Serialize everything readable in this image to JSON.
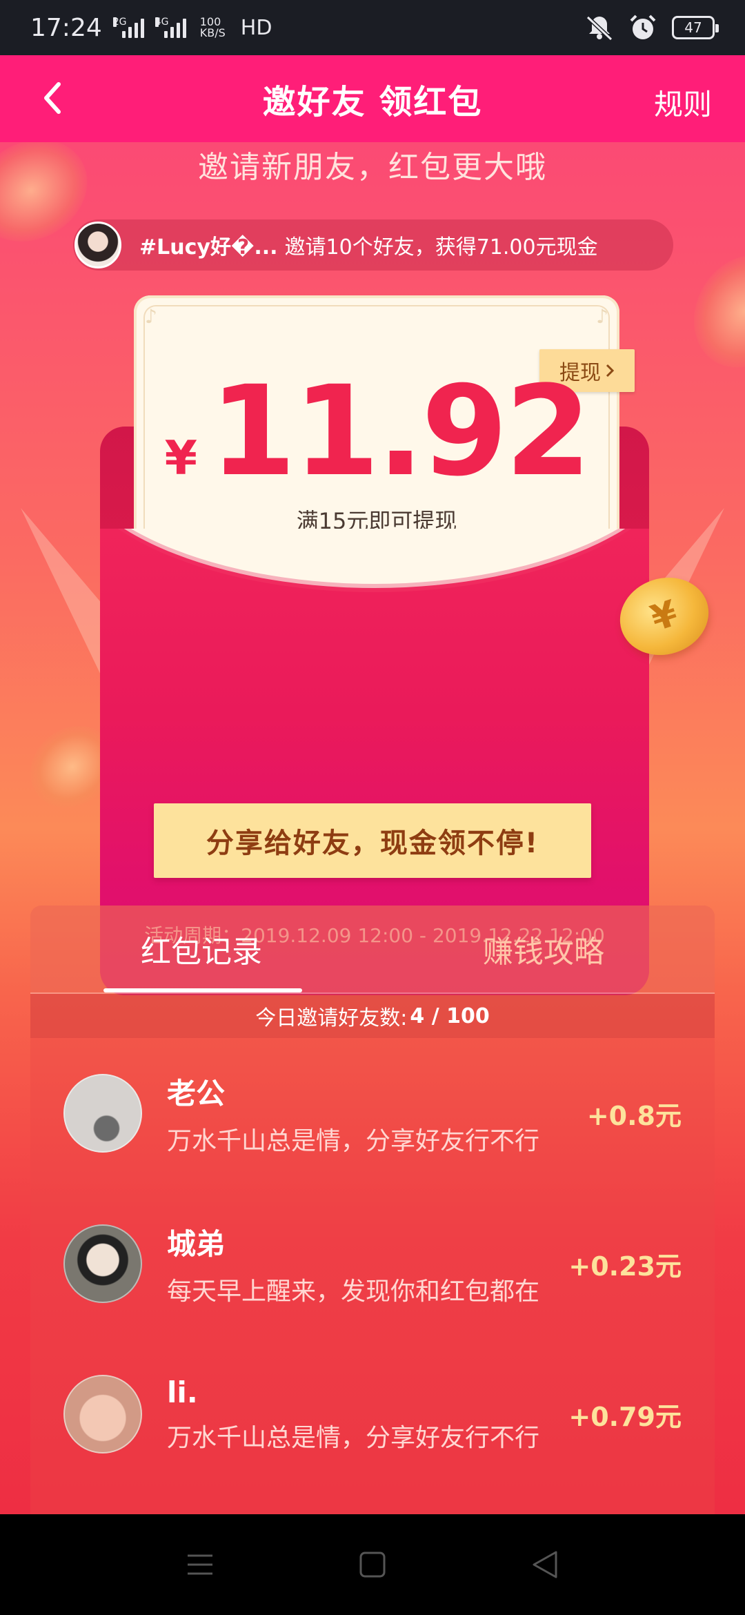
{
  "status_bar": {
    "time": "17:24",
    "sim1_label": "2G",
    "sim2_label": "4G",
    "net_speed_value": "100",
    "net_speed_unit": "KB/S",
    "hd_label": "HD",
    "battery": "47"
  },
  "header": {
    "title": "邀好友 领红包",
    "rules_label": "规则"
  },
  "subtitle": "邀请新朋友，红包更大哦",
  "invite_banner": {
    "user": "#Lucy好�...",
    "text": "邀请10个好友，获得71.00元现金"
  },
  "envelope": {
    "currency": "¥",
    "amount": "11.92",
    "withdraw_label": "提现",
    "min_note": "满15元即可提现",
    "share_button": "分享给好友，现金领不停!",
    "period": "活动周期：2019.12.09 12:00 - 2019.12.22 12:00",
    "coin_symbol": "¥"
  },
  "records": {
    "tabs": [
      {
        "label": "红包记录",
        "active": true
      },
      {
        "label": "赚钱攻略",
        "active": false
      }
    ],
    "daily_label": "今日邀请好友数:",
    "daily_value": "4 / 100",
    "items": [
      {
        "name": "老公",
        "message": "万水千山总是情，分享好友行不行",
        "amount": "+0.8元"
      },
      {
        "name": "城弟",
        "message": "每天早上醒来，发现你和红包都在",
        "amount": "+0.23元"
      },
      {
        "name": "li.",
        "message": "万水千山总是情，分享好友行不行",
        "amount": "+0.79元"
      }
    ]
  },
  "colors": {
    "header_bg": "#ff1e78",
    "amount": "#f0244f",
    "gold_button": "#fde29c"
  },
  "icons": {
    "back": "chevron-left-icon",
    "withdraw_arrow": "chevron-right-icon",
    "nav": [
      "menu-icon",
      "home-square-icon",
      "back-triangle-icon"
    ]
  }
}
